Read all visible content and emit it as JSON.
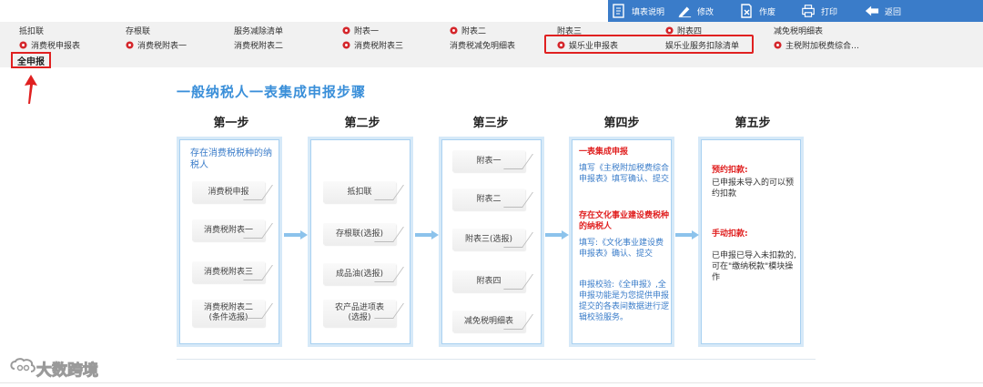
{
  "toolbar": {
    "items": [
      {
        "label": "填表说明",
        "icon": "document-icon"
      },
      {
        "label": "修改",
        "icon": "pencil-icon"
      },
      {
        "label": "作废",
        "icon": "void-document-icon"
      },
      {
        "label": "打印",
        "icon": "printer-icon"
      },
      {
        "label": "返回",
        "icon": "back-arrow-icon"
      }
    ]
  },
  "tabs": {
    "row1": [
      "抵扣联",
      "存根联",
      "服务减除清单",
      "附表一",
      "附表二",
      "附表三",
      "附表四",
      "减免税明细表"
    ],
    "row2": [
      "消费税申报表",
      "消费税附表一",
      "消费税附表二",
      "消费税附表三",
      "消费税减免明细表",
      "娱乐业申报表",
      "娱乐业服务扣除清单",
      "主税附加税费综合…"
    ],
    "full_report": "全申报"
  },
  "main_title": "一般纳税人一表集成申报步骤",
  "steps": [
    {
      "title": "第一步",
      "desc": "存在消费税税种的纳税人",
      "buttons": [
        "消费税申报",
        "消费税附表一",
        "消费税附表三",
        "消费税附表二",
        "(条件选报)"
      ]
    },
    {
      "title": "第二步",
      "buttons": [
        "抵扣联",
        "存根联(选报)",
        "成品油(选报)",
        "农产品进项表",
        "(选报)"
      ]
    },
    {
      "title": "第三步",
      "buttons": [
        "附表一",
        "附表二",
        "附表三(选报)",
        "附表四",
        "减免税明细表"
      ]
    },
    {
      "title": "第四步",
      "h1": "一表集成申报",
      "t1": "填写《主税附加税费综合申报表》填写确认、提交",
      "h2": "存在文化事业建设费税种的纳税人",
      "t2": "填写:《文化事业建设费申报表》确认、提交",
      "t3": "申报校验:《全申报》,全申报功能是为您提供申报提交的各表间数据进行逻辑校验服务。"
    },
    {
      "title": "第五步",
      "h1": "预约扣款:",
      "t1": "已申报未导入的可以预约扣款",
      "h2": "手动扣款:",
      "t2": "已申报已导入未扣款的,可在\"缴纳税款\"模块操作"
    }
  ],
  "watermark": "大数跨境",
  "colors": {
    "toolbar": "#3a7cc9",
    "title": "#3a8fd9",
    "alert": "#e02020",
    "panel_border": "#a9d1f1"
  }
}
